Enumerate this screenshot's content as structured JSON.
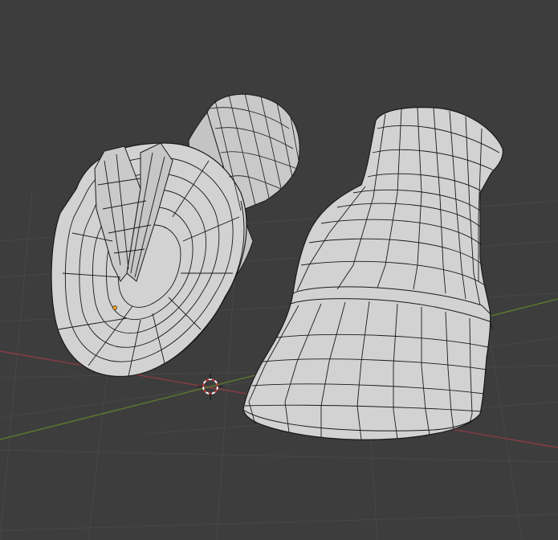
{
  "viewport": {
    "background": "#3d3d3d",
    "grid_color": "#464646",
    "x_axis_color": "#8a3b44",
    "y_axis_color": "#5e7a2e",
    "mesh_fill": "#cfcfcf",
    "mesh_shade": "#b9b9b9",
    "wire_color": "#1a1a1a",
    "origin_color": "#ffa928",
    "cursor_color_a": "#c73a3a",
    "cursor_color_b": "#ffffff"
  },
  "scene": {
    "objects": [
      {
        "name": "hoof-underside-mesh",
        "icon": "mesh-object"
      },
      {
        "name": "hoof-side-mesh",
        "icon": "mesh-object"
      }
    ],
    "cursor_icon": "3d-cursor-icon",
    "origin_icon": "object-origin-icon"
  }
}
